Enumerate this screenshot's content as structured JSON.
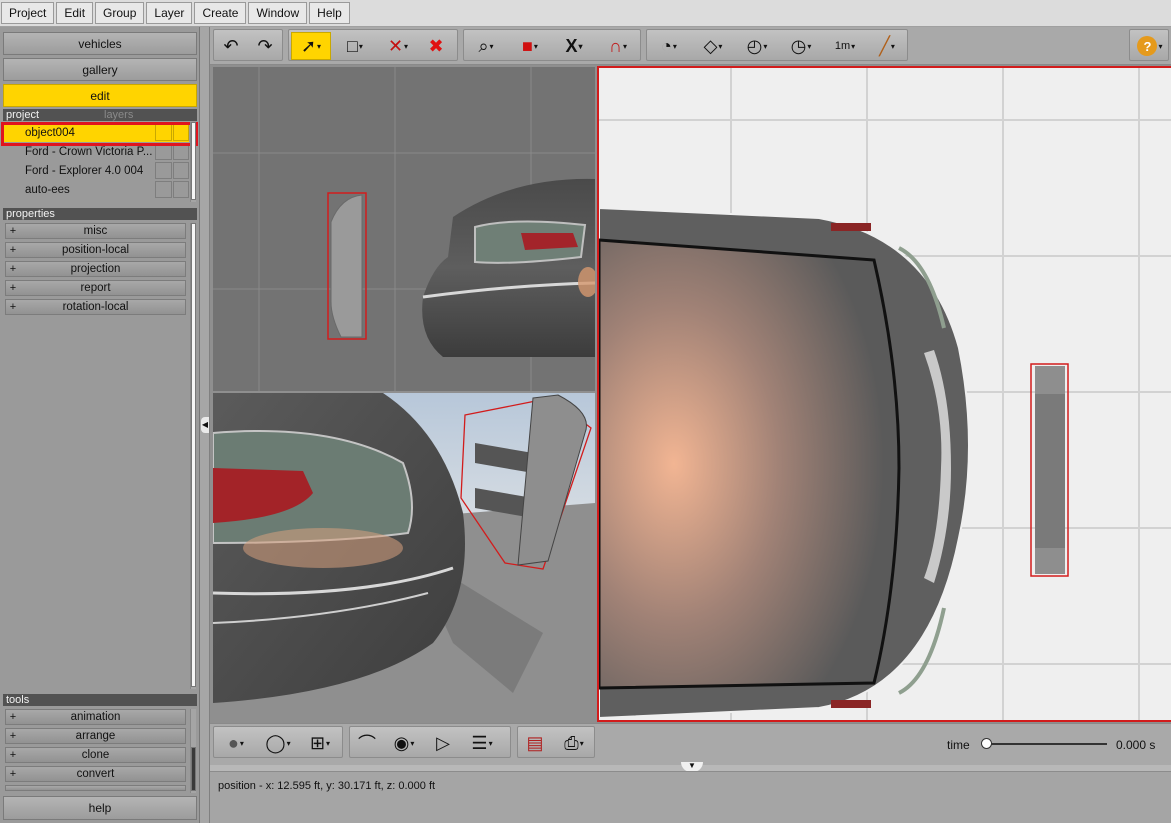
{
  "menu": [
    "Project",
    "Edit",
    "Group",
    "Layer",
    "Create",
    "Window",
    "Help"
  ],
  "nav": {
    "vehicles": "vehicles",
    "gallery": "gallery",
    "edit": "edit"
  },
  "project_panel": {
    "tab_active": "project",
    "tab_inactive": "layers",
    "items": [
      {
        "label": "object004",
        "selected": true
      },
      {
        "label": "Ford - Crown Victoria P...",
        "selected": false
      },
      {
        "label": "Ford - Explorer 4.0 004",
        "selected": false
      },
      {
        "label": "auto-ees",
        "selected": false
      }
    ]
  },
  "properties": {
    "header": "properties",
    "items": [
      "misc",
      "position-local",
      "projection",
      "report",
      "rotation-local"
    ]
  },
  "tools": {
    "header": "tools",
    "items": [
      "animation",
      "arrange",
      "clone",
      "convert"
    ]
  },
  "help_label": "help",
  "toolbar_icons": [
    "undo-icon",
    "redo-icon",
    "select-icon",
    "marquee-icon",
    "delete-point-icon",
    "delete-icon",
    "zoom-icon",
    "cube-icon",
    "axis-icon",
    "magnet-icon",
    "dial-icon",
    "surface-icon",
    "angle-icon",
    "rotate-icon",
    "measure-icon",
    "tape-icon",
    "help-icon"
  ],
  "toolbar_glyphs": {
    "undo": "↶",
    "redo": "↷",
    "select": "➚",
    "marquee": "□",
    "delete_point": "✕",
    "delete": "✖",
    "zoom": "⌕",
    "cube": "■",
    "axis": "X",
    "magnet": "∩",
    "dial": "◔",
    "surface": "◇",
    "angle": "◴",
    "rotate": "◷",
    "measure": "1m",
    "tape": "╱",
    "help": "?"
  },
  "bottom_glyphs": {
    "sphere": "●",
    "shade": "◯",
    "layout": "⊞",
    "graph": "⌒",
    "camera": "◉",
    "play": "▷",
    "list": "☰",
    "doc": "▤",
    "print": "⎙"
  },
  "time": {
    "label": "time",
    "value": "0.000 s",
    "progress": 0
  },
  "status": "position - x: 12.595 ft, y: 30.171 ft, z: 0.000 ft",
  "colors": {
    "accent": "#ffd400",
    "selection": "#e0141e"
  }
}
